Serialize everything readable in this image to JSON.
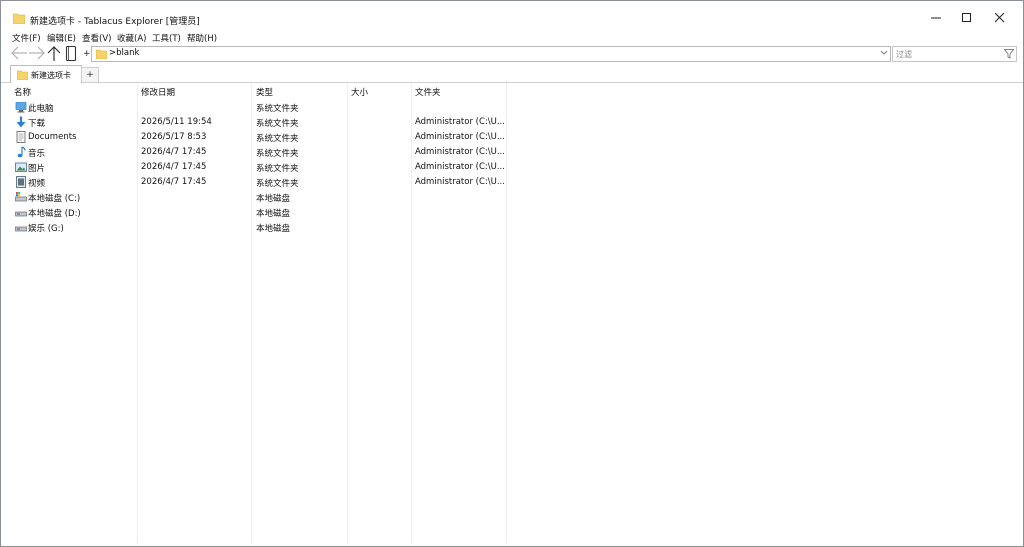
{
  "window": {
    "title": "新建选项卡 - Tablacus Explorer [管理员]"
  },
  "menu": [
    "文件(F)",
    "编辑(E)",
    "查看(V)",
    "收藏(A)",
    "工具(T)",
    "帮助(H)"
  ],
  "address": {
    "plus": "+",
    "value": ">blank"
  },
  "filter": {
    "placeholder": "过滤"
  },
  "tabs": [
    {
      "label": "新建选项卡"
    }
  ],
  "tab_add": "+",
  "columns": [
    "名称",
    "修改日期",
    "类型",
    "大小",
    "文件夹"
  ],
  "rows": [
    {
      "icon": "computer-icon",
      "name": "此电脑",
      "modified": "",
      "type": "系统文件夹",
      "size": "",
      "folder": ""
    },
    {
      "icon": "downloads-icon",
      "name": "下载",
      "modified": "2026/5/11 19:54",
      "type": "系统文件夹",
      "size": "",
      "folder": "Administrator (C:\\U..."
    },
    {
      "icon": "documents-icon",
      "name": "Documents",
      "modified": "2026/5/17 8:53",
      "type": "系统文件夹",
      "size": "",
      "folder": "Administrator (C:\\U..."
    },
    {
      "icon": "music-icon",
      "name": "音乐",
      "modified": "2026/4/7 17:45",
      "type": "系统文件夹",
      "size": "",
      "folder": "Administrator (C:\\U..."
    },
    {
      "icon": "pictures-icon",
      "name": "图片",
      "modified": "2026/4/7 17:45",
      "type": "系统文件夹",
      "size": "",
      "folder": "Administrator (C:\\U..."
    },
    {
      "icon": "videos-icon",
      "name": "视频",
      "modified": "2026/4/7 17:45",
      "type": "系统文件夹",
      "size": "",
      "folder": "Administrator (C:\\U..."
    },
    {
      "icon": "system-drive-icon",
      "name": "本地磁盘 (C:)",
      "modified": "",
      "type": "本地磁盘",
      "size": "",
      "folder": ""
    },
    {
      "icon": "drive-icon",
      "name": "本地磁盘 (D:)",
      "modified": "",
      "type": "本地磁盘",
      "size": "",
      "folder": ""
    },
    {
      "icon": "drive-icon",
      "name": "娱乐 (G:)",
      "modified": "",
      "type": "本地磁盘",
      "size": "",
      "folder": ""
    }
  ],
  "colors": {
    "folder_yellow": "#f7d36b",
    "blue_accent": "#2f7fd1"
  }
}
